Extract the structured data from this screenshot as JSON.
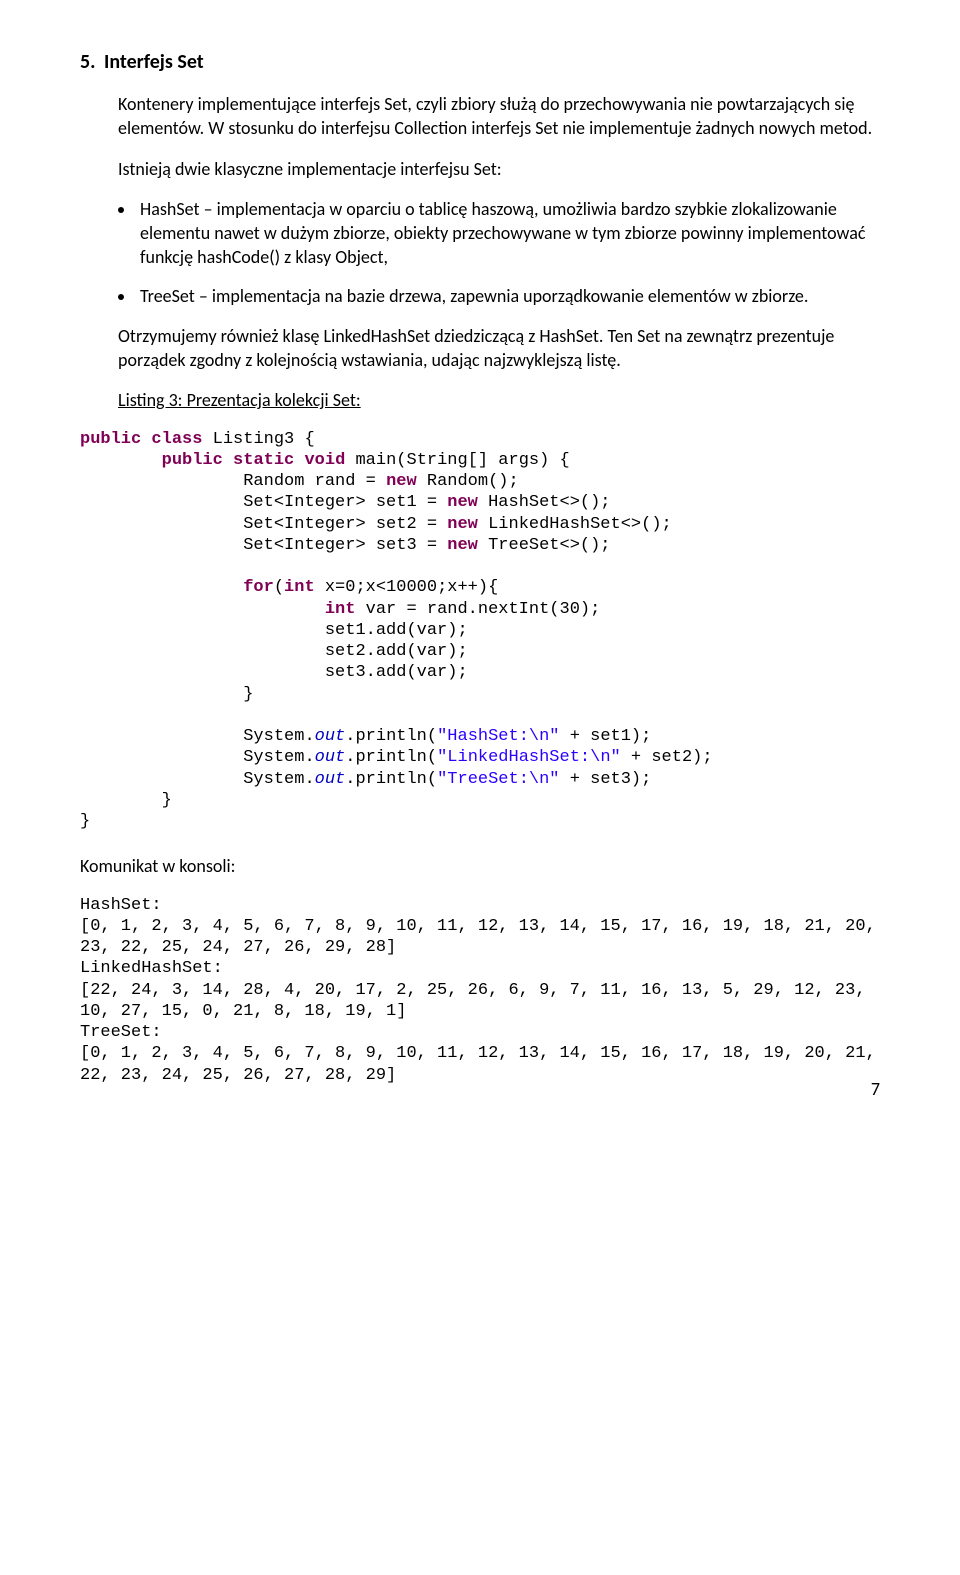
{
  "section": {
    "number": "5.",
    "title": "Interfejs Set"
  },
  "para1": "Kontenery implementujące interfejs Set, czyli zbiory służą do przechowywania nie powtarzających się elementów. W stosunku do interfejsu Collection interfejs Set nie implementuje żadnych nowych metod.",
  "para2": "Istnieją dwie klasyczne implementacje interfejsu Set:",
  "bullets": [
    "HashSet – implementacja w oparciu o tablicę haszową, umożliwia bardzo szybkie zlokalizowanie elementu nawet w dużym zbiorze, obiekty przechowywane w tym zbiorze powinny implementować funkcję hashCode() z klasy Object,",
    "TreeSet – implementacja na bazie drzewa, zapewnia uporządkowanie elementów w zbiorze."
  ],
  "para3": "Otrzymujemy również klasę LinkedHashSet dziedziczącą z HashSet. Ten Set na zewnątrz prezentuje porządek zgodny z kolejnością wstawiania, udając najzwyklejszą listę.",
  "listing_label": "Listing 3: Prezentacja kolekcji Set:",
  "code": {
    "kw_public": "public",
    "kw_class": "class",
    "cls_name": "Listing3 {",
    "kw_static": "static",
    "kw_void": "void",
    "main_sig": "main(String[] args) {",
    "line_rand_a": "Random rand = ",
    "kw_new": "new",
    "line_rand_b": " Random();",
    "line_set1_a": "Set<Integer> set1 = ",
    "line_set1_b": " HashSet<>();",
    "line_set2_a": "Set<Integer> set2 = ",
    "line_set2_b": " LinkedHashSet<>();",
    "line_set3_a": "Set<Integer> set3 = ",
    "line_set3_b": " TreeSet<>();",
    "kw_for": "for",
    "for_cond_a": "(",
    "kw_int": "int",
    "for_cond_b": " x=0;x<10000;x++){",
    "line_var_a": " var = rand.nextInt(30);",
    "line_add1": "set1.add(var);",
    "line_add2": "set2.add(var);",
    "line_add3": "set3.add(var);",
    "brace_close": "}",
    "sys": "System.",
    "out": "out",
    "println": ".println(",
    "str_hs": "\"HashSet:\\n\"",
    "plus_set1": " + set1);",
    "str_lhs": "\"LinkedHashSet:\\n\"",
    "plus_set2": " + set2);",
    "str_ts": "\"TreeSet:\\n\"",
    "plus_set3": " + set3);"
  },
  "console_label": "Komunikat w konsoli:",
  "console_output": "HashSet:\n[0, 1, 2, 3, 4, 5, 6, 7, 8, 9, 10, 11, 12, 13, 14, 15, 17, 16, 19, 18, 21, 20, 23, 22, 25, 24, 27, 26, 29, 28]\nLinkedHashSet:\n[22, 24, 3, 14, 28, 4, 20, 17, 2, 25, 26, 6, 9, 7, 11, 16, 13, 5, 29, 12, 23, 10, 27, 15, 0, 21, 8, 18, 19, 1]\nTreeSet:\n[0, 1, 2, 3, 4, 5, 6, 7, 8, 9, 10, 11, 12, 13, 14, 15, 16, 17, 18, 19, 20, 21, 22, 23, 24, 25, 26, 27, 28, 29]",
  "page_number": "7"
}
